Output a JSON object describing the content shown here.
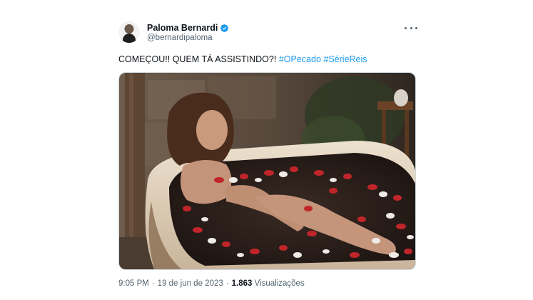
{
  "tweet": {
    "author": {
      "display_name": "Paloma Bernardi",
      "handle": "@bernardipaloma",
      "verified": true,
      "verified_color": "#1d9bf0",
      "avatar_icon": "user-avatar"
    },
    "text_main": "COMEÇOU!! QUEM TÁ ASSISTINDO?!",
    "hashtags": [
      "#OPecado",
      "#SérieReis"
    ],
    "hashtag_color": "#1d9bf0",
    "media_icon": "photo-bathtub-rose-petals",
    "time": "9:05 PM",
    "separator": "·",
    "date": "19 de jun de 2023",
    "views_count": "1.863",
    "views_label": "Visualizações",
    "more_icon": "more-options-icon"
  }
}
